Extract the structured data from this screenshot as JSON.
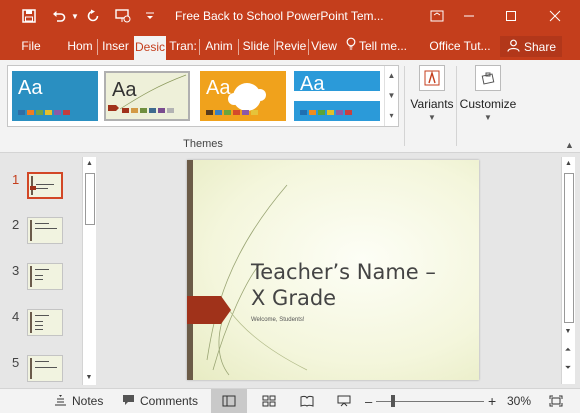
{
  "title_bar": {
    "document_title": "Free Back to School PowerPoint Tem...",
    "quick_access": {
      "save_icon": "floppy-disk-icon",
      "undo_icon": "undo-icon",
      "undo_dropdown_icon": "chevron-down-icon",
      "redo_icon": "redo-icon",
      "present_icon": "present-from-start-icon",
      "customize_icon": "customize-quick-access-icon"
    },
    "window_controls": {
      "restore_icon": "ribbon-display-options-icon",
      "minimize_icon": "minimize-icon",
      "maximize_icon": "maximize-icon",
      "close_icon": "close-icon"
    }
  },
  "tabs": [
    {
      "label": "File",
      "active": false
    },
    {
      "label": "Hom",
      "active": false
    },
    {
      "label": "Inser",
      "active": false
    },
    {
      "label": "Desic",
      "active": true
    },
    {
      "label": "Tran:",
      "active": false
    },
    {
      "label": "Anim",
      "active": false
    },
    {
      "label": "Slide",
      "active": false
    },
    {
      "label": "Revie",
      "active": false
    },
    {
      "label": "View",
      "active": false
    }
  ],
  "tell_me": {
    "label": "Tell me...",
    "icon": "lightbulb-icon"
  },
  "office_tutorials": {
    "label": "Office Tut..."
  },
  "share": {
    "label": "Share",
    "icon": "person-icon"
  },
  "ribbon": {
    "themes_group_label": "Themes",
    "themes": [
      {
        "sample_text": "Aa",
        "bg": "#2a8fc1",
        "fg": "#ffffff",
        "swatches": [
          "#2e6ea6",
          "#ef7d22",
          "#74a344",
          "#e5c02c",
          "#8a5aa8",
          "#c33d3d"
        ]
      },
      {
        "sample_text": "Aa",
        "bg": "#eef0d9",
        "fg": "#333333",
        "swatches": [
          "#a0321a",
          "#d39a45",
          "#6f8f3e",
          "#3f6b8f",
          "#7a4c8f",
          "#b3b3b3"
        ]
      },
      {
        "sample_text": "Aa",
        "bg": "#f0a21c",
        "fg": "#ffffff",
        "swatches": [
          "#5a3c1b",
          "#3b7fbf",
          "#6aa53b",
          "#d44a2b",
          "#8b5aa8",
          "#e6c33a"
        ]
      },
      {
        "sample_text": "Aa",
        "bg": "#2b9ad9",
        "fg": "#ffffff",
        "swatches": [
          "#1f6fb2",
          "#f08c1f",
          "#5aa43b",
          "#e0c12a",
          "#8c5ca8",
          "#c84040"
        ]
      }
    ],
    "gallery_up_icon": "scroll-up-icon",
    "gallery_down_icon": "scroll-down-icon",
    "gallery_more_icon": "more-icon",
    "variants": {
      "label": "Variants",
      "icon": "variants-icon",
      "dropdown_icon": "chevron-down-icon"
    },
    "customize": {
      "label": "Customize",
      "icon": "customize-icon",
      "dropdown_icon": "chevron-down-icon"
    },
    "collapse_icon": "collapse-ribbon-icon"
  },
  "slide_thumbnails": [
    {
      "number": "1",
      "active": true
    },
    {
      "number": "2",
      "active": false
    },
    {
      "number": "3",
      "active": false
    },
    {
      "number": "4",
      "active": false
    },
    {
      "number": "5",
      "active": false
    }
  ],
  "slide": {
    "title_line1": "Teacher’s Name –",
    "title_line2": "X Grade",
    "subtitle": "Welcome, Students!"
  },
  "status_bar": {
    "notes_label": "Notes",
    "notes_icon": "notes-icon",
    "comments_label": "Comments",
    "comments_icon": "comment-icon",
    "normal_view_icon": "normal-view-icon",
    "slide_sorter_icon": "slide-sorter-icon",
    "reading_view_icon": "reading-view-icon",
    "slideshow_icon": "slideshow-icon",
    "zoom_out": "–",
    "zoom_in": "+",
    "zoom_level": "30%",
    "fit_icon": "fit-slide-icon"
  },
  "colors": {
    "accent": "#c43e1c",
    "ribbon_bg": "#f3f3f3",
    "workspace_bg": "#e6e6e6"
  }
}
